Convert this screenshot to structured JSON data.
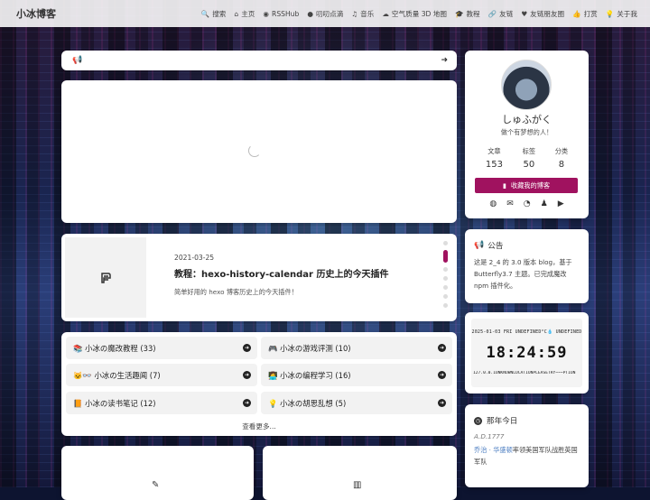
{
  "nav": {
    "brand": "小冰博客",
    "items": [
      {
        "icon": "🔍",
        "label": "搜索"
      },
      {
        "icon": "⌂",
        "label": "主页"
      },
      {
        "icon": "◉",
        "label": "RSSHub"
      },
      {
        "icon": "●",
        "label": "叨叨点滴"
      },
      {
        "icon": "♫",
        "label": "音乐"
      },
      {
        "icon": "☁",
        "label": "空气质量 3D 地图"
      },
      {
        "icon": "🎓",
        "label": "教程"
      },
      {
        "icon": "🔗",
        "label": "友链"
      },
      {
        "icon": "♥",
        "label": "友链朋友圈"
      },
      {
        "icon": "👍",
        "label": "打赏"
      },
      {
        "icon": "💡",
        "label": "关于我"
      }
    ]
  },
  "notice_bar": {
    "icon": "📢",
    "arrow": "➜"
  },
  "post": {
    "date": "2021-03-25",
    "title": "教程：hexo-history-calendar 历史上的今天插件",
    "desc": "简单好用的 hexo 博客历史上的今天插件！"
  },
  "categories": {
    "items": [
      {
        "label": "📚 小冰の魔改教程 (33)"
      },
      {
        "label": "🎮 小冰の游戏评测 (10)"
      },
      {
        "label": "🐱‍👓 小冰の生活趣闻 (7)"
      },
      {
        "label": "👩‍💻 小冰の编程学习 (16)"
      },
      {
        "label": "📙 小冰の读书笔记 (12)"
      },
      {
        "label": "💡 小冰の胡思乱想 (5)"
      }
    ],
    "more": "查看更多..."
  },
  "profile": {
    "name": "しゅふがく",
    "motto": "做个有梦想的人！",
    "stats": [
      {
        "label": "文章",
        "value": "153"
      },
      {
        "label": "标签",
        "value": "50"
      },
      {
        "label": "分类",
        "value": "8"
      }
    ],
    "bookmark_label": "收藏我的博客"
  },
  "announcement": {
    "title": "公告",
    "body": "这是 2_4 的 3.0 版本 blog，基于 Butterfly3.7 主题。已完成魔改 npm 插件化。"
  },
  "clock": {
    "date": "2025-01-03 FRI UNDEFINED°C💧 UNDEFINED",
    "time": "18:24:59",
    "location": "127.0.0.1UNKNOWNLOCATIONPLEASETRY~~~PTION"
  },
  "today": {
    "title": "那年今日",
    "date": "A.D.1777",
    "event_link": "乔治 · 华盛顿",
    "event_text": "率领美国军队战胜英国军队"
  },
  "colors": {
    "accent": "#a0125f",
    "link": "#4e7fc2",
    "notice_icon": "#d62b2b"
  }
}
